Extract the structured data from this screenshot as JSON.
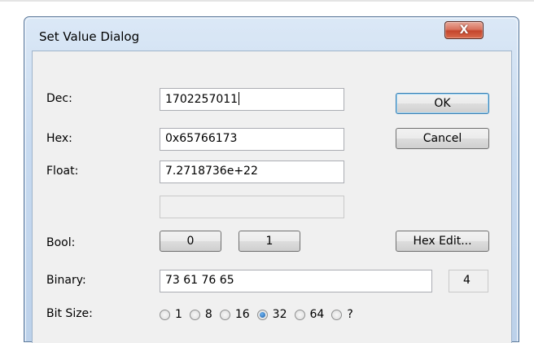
{
  "dialog": {
    "title": "Set Value Dialog",
    "close_label": "X"
  },
  "fields": {
    "dec_label": "Dec:",
    "dec_value": "1702257011",
    "hex_label": "Hex:",
    "hex_value": "0x65766173",
    "float_label": "Float:",
    "float_value": "7.2718736e+22",
    "extra_value": "",
    "bool_label": "Bool:",
    "binary_label": "Binary:",
    "binary_value": "73 61 76 65",
    "binary_size": "4",
    "bitsize_label": "Bit Size:"
  },
  "buttons": {
    "ok": "OK",
    "cancel": "Cancel",
    "bool_0": "0",
    "bool_1": "1",
    "hex_edit": "Hex Edit..."
  },
  "bit_sizes": {
    "options": [
      "1",
      "8",
      "16",
      "32",
      "64",
      "?"
    ],
    "selected": "32"
  },
  "colors": {
    "close_button": "#c4452c",
    "default_button_border": "#3c7fb1"
  }
}
